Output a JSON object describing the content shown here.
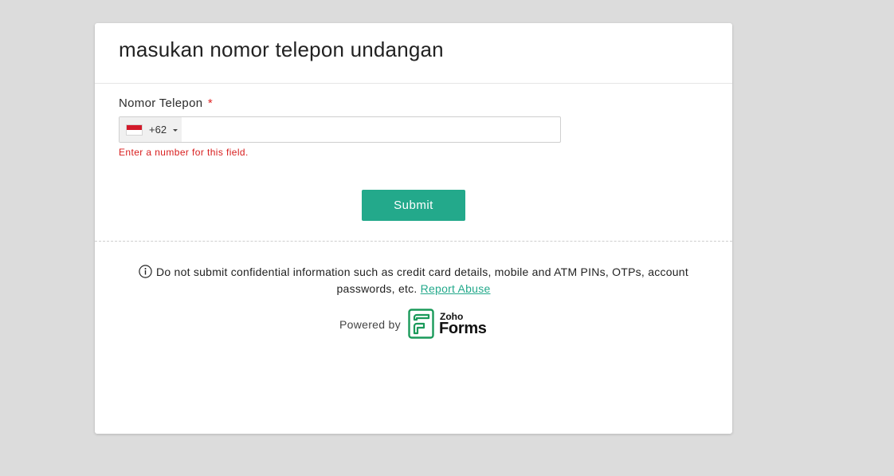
{
  "form": {
    "title": "masukan nomor telepon undangan"
  },
  "phone_field": {
    "label": "Nomor Telepon",
    "required_marker": "*",
    "country_code": "+62",
    "country_flag": "indonesia-flag",
    "value": "",
    "placeholder": "",
    "error": "Enter a number for this field."
  },
  "actions": {
    "submit_label": "Submit"
  },
  "footer": {
    "notice": "Do not submit confidential information such as credit card details, mobile and ATM PINs, OTPs, account passwords, etc.",
    "report_link": "Report Abuse",
    "powered_by": "Powered by",
    "logo_top": "Zoho",
    "logo_bottom": "Forms"
  },
  "colors": {
    "accent": "#23a98b",
    "error": "#d81e1e",
    "background": "#dcdcdc",
    "flag_red": "#d21a2a"
  },
  "icons": {
    "info": "info-icon",
    "caret": "caret-down-icon"
  }
}
